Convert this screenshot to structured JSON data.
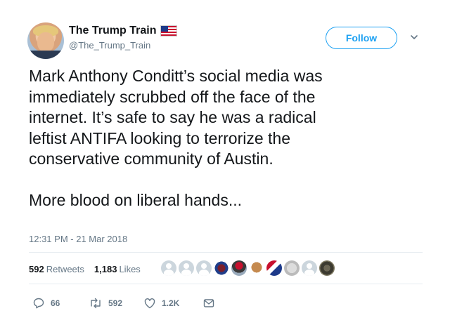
{
  "user": {
    "display_name": "The Trump Train",
    "handle": "@The_Trump_Train"
  },
  "header": {
    "follow_label": "Follow"
  },
  "tweet": {
    "text": "Mark Anthony Conditt’s social media was\nimmediately scrubbed off the face of the\ninternet. It’s safe to say he was a radical\nleftist ANTIFA looking to terrorize the\nconservative community of Austin.\n\nMore blood on liberal hands...",
    "timestamp": "12:31 PM - 21 Mar 2018"
  },
  "stats": {
    "retweets_count": "592",
    "retweets_label": "Retweets",
    "likes_count": "1,183",
    "likes_label": "Likes"
  },
  "actions": {
    "replies": "66",
    "retweets": "592",
    "likes": "1.2K"
  },
  "colors": {
    "accent": "#1da1f2",
    "secondary_text": "#657786",
    "primary_text": "#14171a"
  }
}
